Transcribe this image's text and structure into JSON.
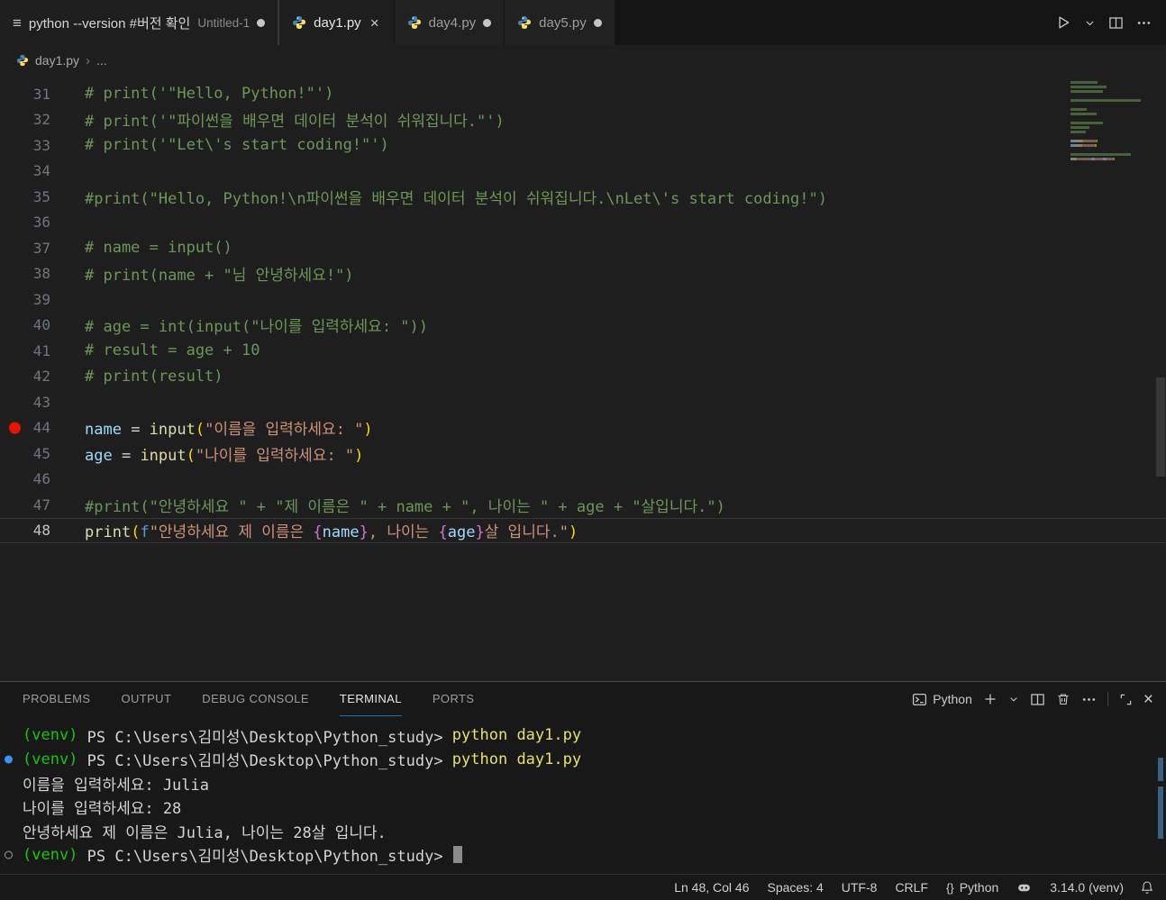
{
  "colors": {
    "accent": "#0078d4",
    "breakpoint": "#e51400",
    "decoration_blue": "#3794ff"
  },
  "icons": {
    "plaintext_file": "≡",
    "close": "×",
    "breadcrumb_separator": "›"
  },
  "tab_bar": {
    "untitled_tab": {
      "title": "python --version #버전 확인",
      "description": "Untitled-1"
    },
    "tabs": [
      {
        "label": "day1.py"
      },
      {
        "label": "day4.py"
      },
      {
        "label": "day5.py"
      }
    ]
  },
  "breadcrumb": {
    "file": "day1.py",
    "more": "..."
  },
  "editor": {
    "active_line": 48,
    "breakpoint_line": 44,
    "lines": [
      {
        "num": 31,
        "seg": [
          [
            "# print('\"Hello, Python!\"')",
            "c"
          ]
        ]
      },
      {
        "num": 32,
        "seg": [
          [
            "# print('\"파이썬을 배우면 데이터 분석이 쉬워집니다.\"')",
            "c"
          ]
        ]
      },
      {
        "num": 33,
        "seg": [
          [
            "# print('\"Let\\'s start coding!\"')",
            "c"
          ]
        ]
      },
      {
        "num": 34,
        "seg": []
      },
      {
        "num": 35,
        "seg": [
          [
            "#print(\"Hello, Python!\\n파이썬을 배우면 데이터 분석이 쉬워집니다.\\nLet\\'s start coding!\")",
            "c"
          ]
        ]
      },
      {
        "num": 36,
        "seg": []
      },
      {
        "num": 37,
        "seg": [
          [
            "# name = input()",
            "c"
          ]
        ]
      },
      {
        "num": 38,
        "seg": [
          [
            "# print(name + \"님 안녕하세요!\")",
            "c"
          ]
        ]
      },
      {
        "num": 39,
        "seg": []
      },
      {
        "num": 40,
        "seg": [
          [
            "# age = int(input(\"나이를 입력하세요: \"))",
            "c"
          ]
        ]
      },
      {
        "num": 41,
        "seg": [
          [
            "# result = age + 10",
            "c"
          ]
        ]
      },
      {
        "num": 42,
        "seg": [
          [
            "# print(result)",
            "c"
          ]
        ]
      },
      {
        "num": 43,
        "seg": []
      },
      {
        "num": 44,
        "seg": [
          [
            "name",
            "v"
          ],
          [
            " = ",
            "d"
          ],
          [
            "input",
            "f"
          ],
          [
            "(",
            "p"
          ],
          [
            "\"이름을 입력하세요: \"",
            "s"
          ],
          [
            ")",
            "p"
          ]
        ]
      },
      {
        "num": 45,
        "seg": [
          [
            "age",
            "v"
          ],
          [
            " = ",
            "d"
          ],
          [
            "input",
            "f"
          ],
          [
            "(",
            "p"
          ],
          [
            "\"나이를 입력하세요: \"",
            "s"
          ],
          [
            ")",
            "p"
          ]
        ]
      },
      {
        "num": 46,
        "seg": []
      },
      {
        "num": 47,
        "seg": [
          [
            "#print(\"안녕하세요 \" + \"제 이름은 \" + name + \", 나이는 \" + age + \"살입니다.\")",
            "c"
          ]
        ]
      },
      {
        "num": 48,
        "seg": [
          [
            "print",
            "f"
          ],
          [
            "(",
            "p"
          ],
          [
            "f",
            "k"
          ],
          [
            "\"안녕하세요 제 이름은 ",
            "s"
          ],
          [
            "{",
            "b"
          ],
          [
            "name",
            "v"
          ],
          [
            "}",
            "b"
          ],
          [
            ", 나이는 ",
            "s"
          ],
          [
            "{",
            "b"
          ],
          [
            "age",
            "v"
          ],
          [
            "}",
            "b"
          ],
          [
            "살 입니다.\"",
            "s"
          ],
          [
            ")",
            "p"
          ]
        ]
      }
    ]
  },
  "panel": {
    "tabs": [
      "PROBLEMS",
      "OUTPUT",
      "DEBUG CONSOLE",
      "TERMINAL",
      "PORTS"
    ],
    "active_tab": "TERMINAL",
    "profile_label": "Python"
  },
  "terminal": {
    "lines": [
      {
        "seg": [
          [
            "(venv)",
            "g"
          ],
          [
            " PS C:\\Users\\김미성\\Desktop\\Python_study> ",
            "d"
          ],
          [
            "python day1.py",
            "y"
          ]
        ],
        "decoration": null
      },
      {
        "seg": [
          [
            "(venv)",
            "g"
          ],
          [
            " PS C:\\Users\\김미성\\Desktop\\Python_study> ",
            "d"
          ],
          [
            "python day1.py",
            "y"
          ]
        ],
        "decoration": "success"
      },
      {
        "seg": [
          [
            "이름을 입력하세요: Julia",
            "d"
          ]
        ],
        "decoration": null
      },
      {
        "seg": [
          [
            "나이를 입력하세요: 28",
            "d"
          ]
        ],
        "decoration": null
      },
      {
        "seg": [
          [
            "안녕하세요 제 이름은 Julia, 나이는 28살 입니다.",
            "d"
          ]
        ],
        "decoration": null
      },
      {
        "seg": [
          [
            "(venv)",
            "g"
          ],
          [
            " PS C:\\Users\\김미성\\Desktop\\Python_study> ",
            "d"
          ]
        ],
        "decoration": "prompt",
        "cursor": true
      }
    ]
  },
  "status_bar": {
    "cursor": "Ln 48, Col 46",
    "indent": "Spaces: 4",
    "encoding": "UTF-8",
    "eol": "CRLF",
    "language_icon": "{}",
    "language": "Python",
    "interpreter": "3.14.0 (venv)"
  }
}
